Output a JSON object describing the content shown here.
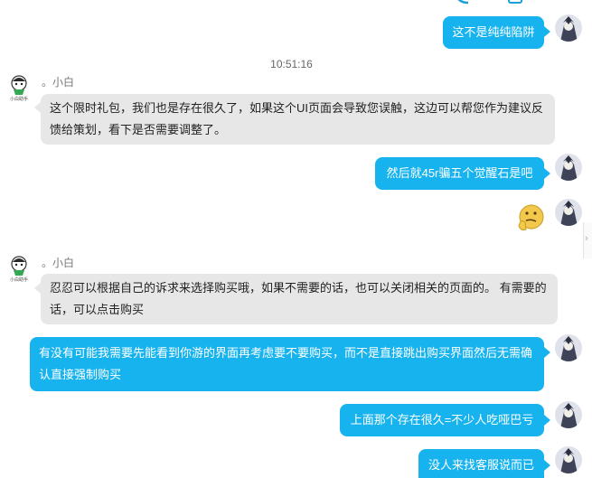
{
  "timestamp": "10:51:16",
  "agent": {
    "name": "。小白",
    "avatar_caption": "小白助手"
  },
  "messages": [
    {
      "id": 1,
      "side": "out",
      "text": "这不是纯纯陷阱"
    },
    {
      "id": 2,
      "side": "in",
      "line1": "这个限时礼包，我们也是存在很久了，如果这个UI页面会导致您误触，这边可以帮您作为建议反",
      "line2": "馈给策划，看下是否需要调整了。"
    },
    {
      "id": 3,
      "side": "out",
      "text": "然后就45r骗五个觉醒石是吧"
    },
    {
      "id": 4,
      "side": "out",
      "sticker": "thinking-emoji-sticker"
    },
    {
      "id": 5,
      "side": "in",
      "line1": "忍忍可以根据自己的诉求来选择购买哦，如果不需要的话，也可以关闭相关的页面的。 有需要的",
      "line2": "话，可以点击购买"
    },
    {
      "id": 6,
      "side": "out",
      "line1": "有没有可能我需要先能看到你游的界面再考虑要不要购买，而不是直接跳出购买界面然后无需确",
      "line2": "认直接强制购买"
    },
    {
      "id": 7,
      "side": "out",
      "text": "上面那个存在很久=不少人吃哑巴亏"
    },
    {
      "id": 8,
      "side": "out",
      "text": "没人来找客服说而已"
    }
  ],
  "colors": {
    "outgoing": "#17b3ee",
    "incoming": "#e7e7e7",
    "text_light": "#ffffff",
    "meta": "#777777"
  }
}
